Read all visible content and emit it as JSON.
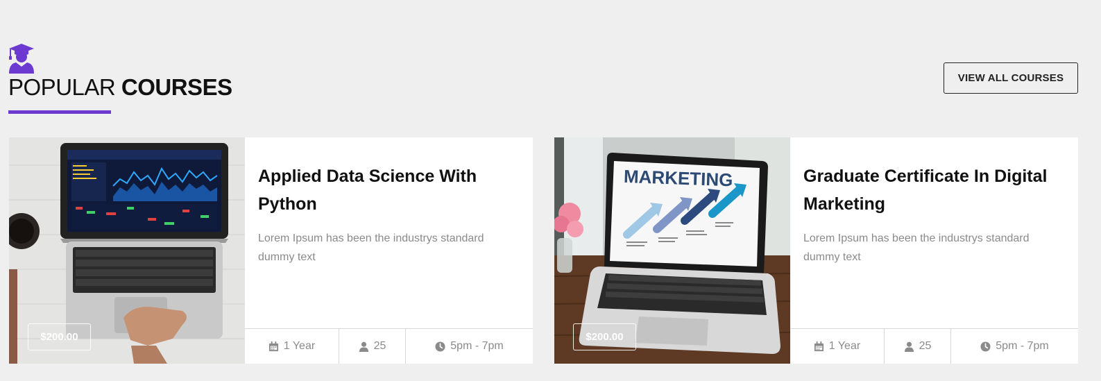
{
  "section": {
    "title_light": "POPULAR",
    "title_bold": "COURSES",
    "view_all_label": "VIEW ALL COURSES",
    "accent_color": "#6c3ad1",
    "icon": "graduate-icon"
  },
  "courses": [
    {
      "title": "Applied Data Science With Python",
      "description": "Lorem Ipsum has been the industrys standard dummy text",
      "price": "$200.00",
      "duration": "1 Year",
      "students": "25",
      "time": "5pm - 7pm",
      "image": "laptop-with-financial-charts"
    },
    {
      "title": "Graduate Certificate In Digital Marketing",
      "description": "Lorem Ipsum has been the industrys standard dummy text",
      "price": "$200.00",
      "duration": "1 Year",
      "students": "25",
      "time": "5pm - 7pm",
      "image": "laptop-showing-marketing-slide",
      "image_text": "MARKETING"
    }
  ],
  "meta_icons": [
    "calendar-icon",
    "user-icon",
    "clock-icon"
  ]
}
